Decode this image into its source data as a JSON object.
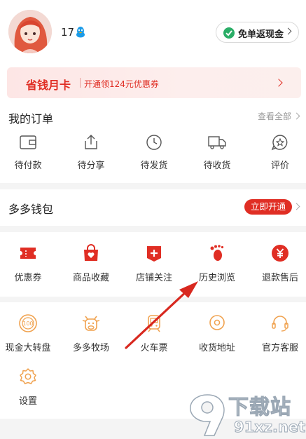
{
  "profile": {
    "username": "17",
    "avatar_icon": "girl-avatar",
    "badge_icon": "qq-penguin-icon"
  },
  "cashback_button": {
    "label": "免单返现金"
  },
  "banner": {
    "title": "省钱月卡",
    "subtitle": "开通领124元优惠券"
  },
  "orders": {
    "title": "我的订单",
    "view_all": "查看全部",
    "items": [
      {
        "label": "待付款",
        "icon": "wallet-icon"
      },
      {
        "label": "待分享",
        "icon": "share-icon"
      },
      {
        "label": "待发货",
        "icon": "clock-icon"
      },
      {
        "label": "待收货",
        "icon": "truck-icon"
      },
      {
        "label": "评价",
        "icon": "star-bubble-icon"
      }
    ]
  },
  "wallet": {
    "title": "多多钱包",
    "button": "立即开通"
  },
  "tools_row1": [
    {
      "label": "优惠券",
      "icon": "ticket-icon"
    },
    {
      "label": "商品收藏",
      "icon": "heart-bag-icon"
    },
    {
      "label": "店铺关注",
      "icon": "store-plus-icon"
    },
    {
      "label": "历史浏览",
      "icon": "footprint-icon"
    },
    {
      "label": "退款售后",
      "icon": "yen-refund-icon"
    }
  ],
  "tools_row2": [
    {
      "label": "现金大转盘",
      "icon": "wheel-100-icon"
    },
    {
      "label": "多多牧场",
      "icon": "cow-icon"
    },
    {
      "label": "火车票",
      "icon": "train-icon"
    },
    {
      "label": "收货地址",
      "icon": "location-icon"
    },
    {
      "label": "官方客服",
      "icon": "headset-icon"
    }
  ],
  "tools_row3": [
    {
      "label": "设置",
      "icon": "gear-icon"
    }
  ],
  "watermark": {
    "brand": "下载站",
    "url": "91xz.net",
    "logo_text": "91"
  },
  "colors": {
    "accent": "#e02e24",
    "orange": "#f0a24f",
    "annotation_arrow": "#d8281f"
  }
}
